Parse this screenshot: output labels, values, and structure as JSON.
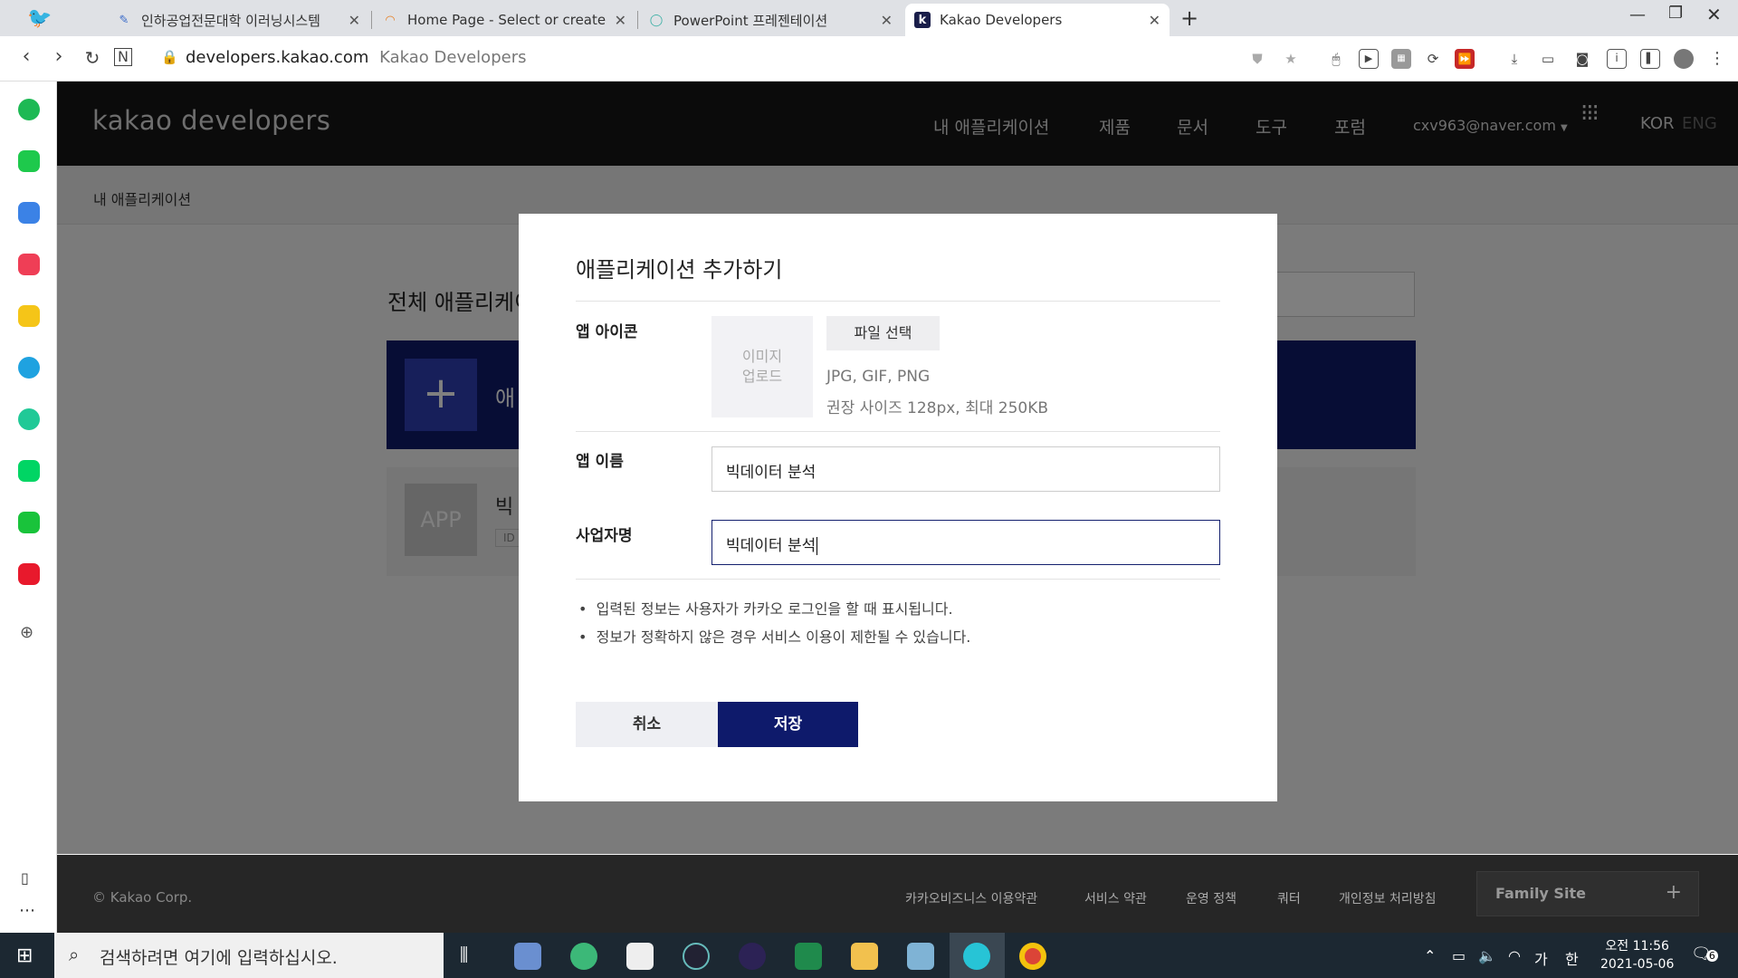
{
  "browser": {
    "tabs": [
      {
        "title": "인하공업전문대학 이러닝시스템",
        "icon": "notepad-icon"
      },
      {
        "title": "Home Page - Select or create a",
        "icon": "loading-spinner-icon"
      },
      {
        "title": "PowerPoint 프레젠테이션",
        "icon": "powerpoint-icon"
      },
      {
        "title": "Kakao Developers",
        "icon": "kakao-k-icon"
      }
    ],
    "url_domain": "developers.kakao.com",
    "url_title": "Kakao Developers"
  },
  "site": {
    "logo": "kakao developers",
    "nav": [
      "내 애플리케이션",
      "제품",
      "문서",
      "도구",
      "포럼"
    ],
    "user": "cxv963@naver.com",
    "lang_active": "KOR",
    "lang_other": "ENG",
    "breadcrumb": "내 애플리케이션",
    "section_title": "전체 애플리케이",
    "add_card_text": "애",
    "app_placeholder": "APP",
    "app_name_partial": "빅",
    "app_id_partial": "ID",
    "footer": {
      "copyright": "© Kakao Corp.",
      "links": [
        "카카오비즈니스 이용약관",
        "서비스 약관",
        "운영 정책",
        "쿼터",
        "개인정보 처리방침"
      ],
      "family_site": "Family Site"
    }
  },
  "modal": {
    "title": "애플리케이션 추가하기",
    "icon_label": "앱 아이콘",
    "image_upload_line1": "이미지",
    "image_upload_line2": "업로드",
    "file_button": "파일 선택",
    "file_types": "JPG, GIF, PNG",
    "file_size_hint": "권장 사이즈 128px, 최대 250KB",
    "app_name_label": "앱 이름",
    "app_name_value": "빅데이터 분석",
    "business_label": "사업자명",
    "business_value": "빅데이터 분석",
    "notes": [
      "입력된 정보는 사용자가 카카오 로그인을 할 때 표시됩니다.",
      "정보가 정확하지 않은 경우 서비스 이용이 제한될 수 있습니다."
    ],
    "cancel": "취소",
    "save": "저장"
  },
  "taskbar": {
    "search_placeholder": "검색하려면 여기에 입력하십시오.",
    "ime": "가",
    "ime2": "한",
    "time": "오전 11:56",
    "date": "2021-05-06",
    "notifications": "6"
  },
  "colors": {
    "header_bg": "#171717",
    "accent_navy": "#0e1a6b"
  }
}
